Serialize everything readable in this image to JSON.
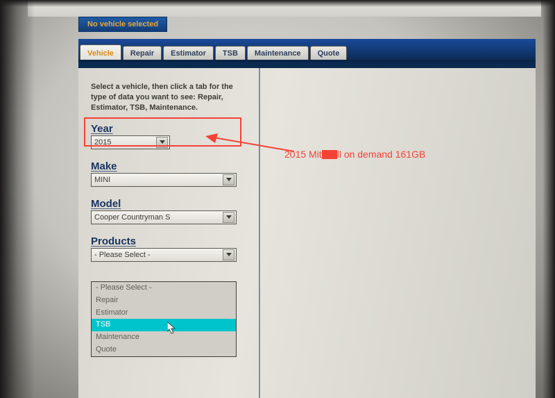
{
  "header": {
    "no_vehicle_label": "No vehicle selected"
  },
  "tabs": {
    "vehicle": "Vehicle",
    "repair": "Repair",
    "estimator": "Estimator",
    "tsb": "TSB",
    "maintenance": "Maintenance",
    "quote": "Quote"
  },
  "sidebar": {
    "instructions": "Select a vehicle, then click a tab for the type of data you want to see: Repair, Estimator, TSB, Maintenance.",
    "year": {
      "label": "Year",
      "value": "2015"
    },
    "make": {
      "label": "Make",
      "value": "MINI"
    },
    "model": {
      "label": "Model",
      "value": "Cooper Countryman S"
    },
    "products": {
      "label": "Products",
      "value": "- Please Select -",
      "options": {
        "please": "- Please Select -",
        "repair": "Repair",
        "estimator": "Estimator",
        "tsb": "TSB",
        "maintenance": "Maintenance",
        "quote": "Quote"
      }
    }
  },
  "annotation": {
    "text_before": "2015 Mit",
    "text_after": "ll on demand 161GB"
  }
}
